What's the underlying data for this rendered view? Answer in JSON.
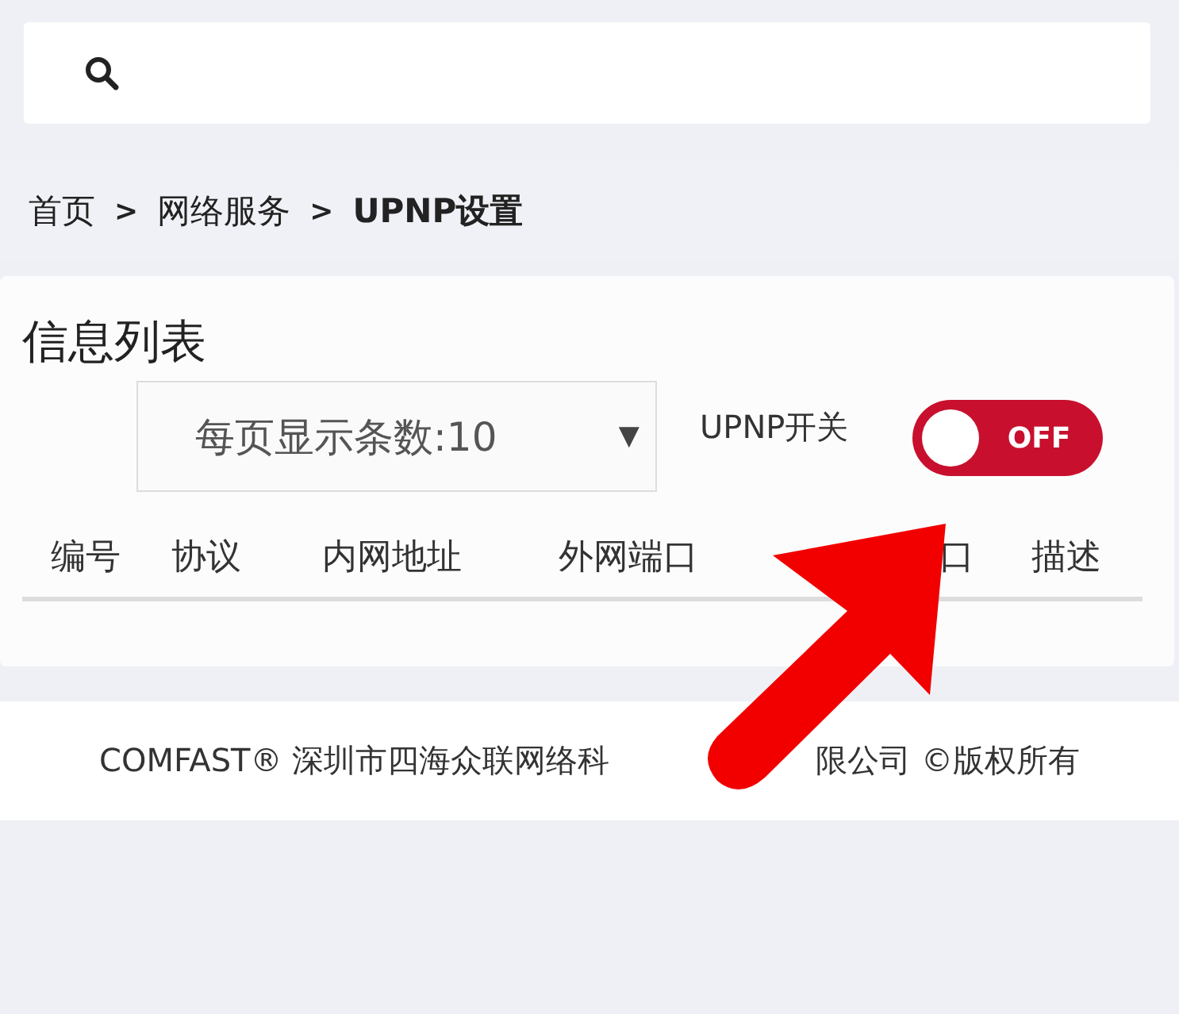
{
  "search": {
    "kind": "search"
  },
  "breadcrumb": [
    {
      "label": "首页"
    },
    {
      "label": "网络服务"
    },
    {
      "label": "UPNP设置"
    }
  ],
  "breadcrumb_separator": ">",
  "card": {
    "title": "信息列表",
    "page_size_select": {
      "value": "每页显示条数:10",
      "caret": "▼"
    },
    "switch": {
      "label": "UPNP开关",
      "on": false,
      "state_text": "OFF"
    },
    "table": {
      "columns": [
        "编号",
        "协议",
        "内网地址",
        "外网端口",
        "口",
        "描述"
      ]
    }
  },
  "footer": [
    "COMFAST® 深圳市四海众联网络科",
    "限公司 ©版权所有"
  ]
}
